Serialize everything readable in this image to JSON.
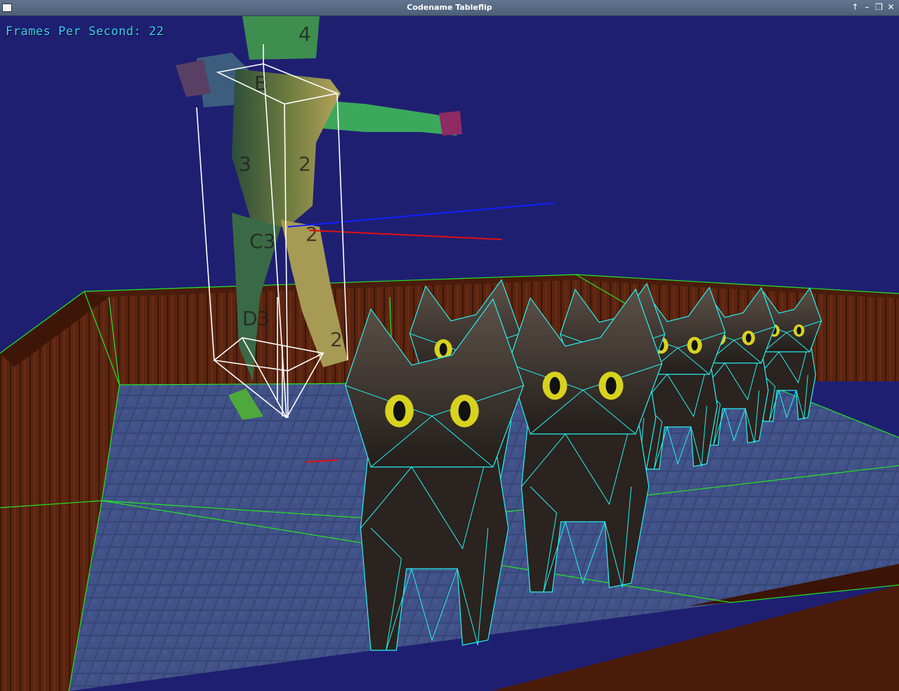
{
  "window": {
    "title": "Codename Tableflip",
    "controls": [
      "arrow-up-icon",
      "minimize-icon",
      "maximize-icon",
      "close-icon"
    ]
  },
  "hud": {
    "fps_label": "Frames Per Second: 22",
    "fps_color": "#3ad0ff"
  },
  "scene": {
    "sky_color": "#1f1f72",
    "floor_tile_color": "#3d4f82",
    "wall_color": "#5a2410",
    "wireframe_color": "#26f0f0",
    "bounding_box_color": "#ffffff",
    "edge_color": "#22e622",
    "character_label_glyphs": [
      "4",
      "B",
      "3",
      "2",
      "C3",
      "2",
      "D3",
      "2"
    ],
    "cat_count": 7
  }
}
